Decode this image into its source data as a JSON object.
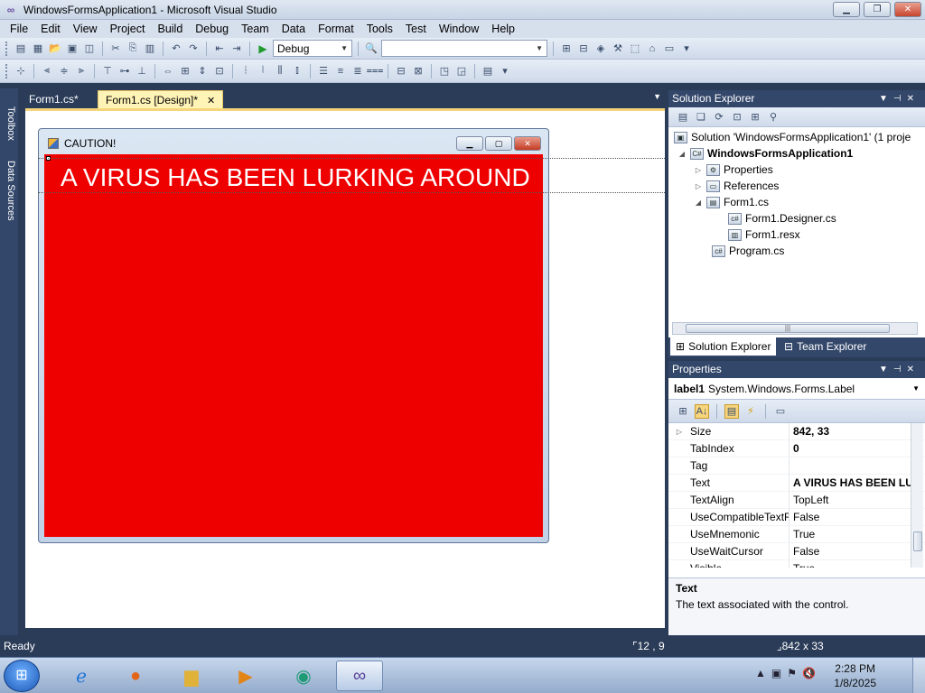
{
  "window": {
    "title": "WindowsFormsApplication1 - Microsoft Visual Studio",
    "logo_icon": "visual-studio-infinity-icon"
  },
  "menu": [
    "File",
    "Edit",
    "View",
    "Project",
    "Build",
    "Debug",
    "Team",
    "Data",
    "Format",
    "Tools",
    "Test",
    "Window",
    "Help"
  ],
  "toolbar": {
    "config_value": "Debug",
    "platform_value": ""
  },
  "left_tabs": {
    "toolbox": "Toolbox",
    "data_sources": "Data Sources"
  },
  "doc_tabs": [
    {
      "label": "Form1.cs*",
      "active": false
    },
    {
      "label": "Form1.cs [Design]*",
      "active": true
    }
  ],
  "form": {
    "title": "CAUTION!",
    "label_text": "A VIRUS HAS BEEN LURKING AROUND",
    "back_color": "#ef0000",
    "text_color": "#ffffff"
  },
  "solution_explorer": {
    "header": "Solution Explorer",
    "nodes": [
      {
        "label": "Solution 'WindowsFormsApplication1' (1 proje",
        "icon": "solution-icon"
      },
      {
        "label": "WindowsFormsApplication1",
        "icon": "csharp-project-icon"
      },
      {
        "label": "Properties",
        "icon": "properties-folder-icon"
      },
      {
        "label": "References",
        "icon": "references-folder-icon"
      },
      {
        "label": "Form1.cs",
        "icon": "form-file-icon"
      },
      {
        "label": "Form1.Designer.cs",
        "icon": "cs-file-icon"
      },
      {
        "label": "Form1.resx",
        "icon": "resx-file-icon"
      },
      {
        "label": "Program.cs",
        "icon": "cs-file-icon"
      }
    ],
    "bottom_tabs": [
      "Solution Explorer",
      "Team Explorer"
    ]
  },
  "properties": {
    "header": "Properties",
    "object_name": "label1",
    "object_type": "System.Windows.Forms.Label",
    "rows": [
      {
        "name": "Size",
        "value": "842, 33",
        "bold": true,
        "expandable": true
      },
      {
        "name": "TabIndex",
        "value": "0",
        "bold": true,
        "expandable": false
      },
      {
        "name": "Tag",
        "value": "",
        "bold": false,
        "expandable": false
      },
      {
        "name": "Text",
        "value": "A VIRUS HAS BEEN LU",
        "bold": true,
        "expandable": false
      },
      {
        "name": "TextAlign",
        "value": "TopLeft",
        "bold": false,
        "expandable": false
      },
      {
        "name": "UseCompatibleTextR",
        "value": "False",
        "bold": false,
        "expandable": false
      },
      {
        "name": "UseMnemonic",
        "value": "True",
        "bold": false,
        "expandable": false
      },
      {
        "name": "UseWaitCursor",
        "value": "False",
        "bold": false,
        "expandable": false
      },
      {
        "name": "Visible",
        "value": "True",
        "bold": false,
        "expandable": false
      }
    ],
    "desc_title": "Text",
    "desc_text": "The text associated with the control."
  },
  "status": {
    "ready": "Ready",
    "position": "12 , 9",
    "size": "842 x 33"
  },
  "taskbar": {
    "apps": [
      "internet-explorer-icon",
      "firefox-icon",
      "file-explorer-icon",
      "media-player-icon",
      "app-icon",
      "visual-studio-icon"
    ],
    "time": "2:28 PM",
    "date": "1/8/2025"
  }
}
